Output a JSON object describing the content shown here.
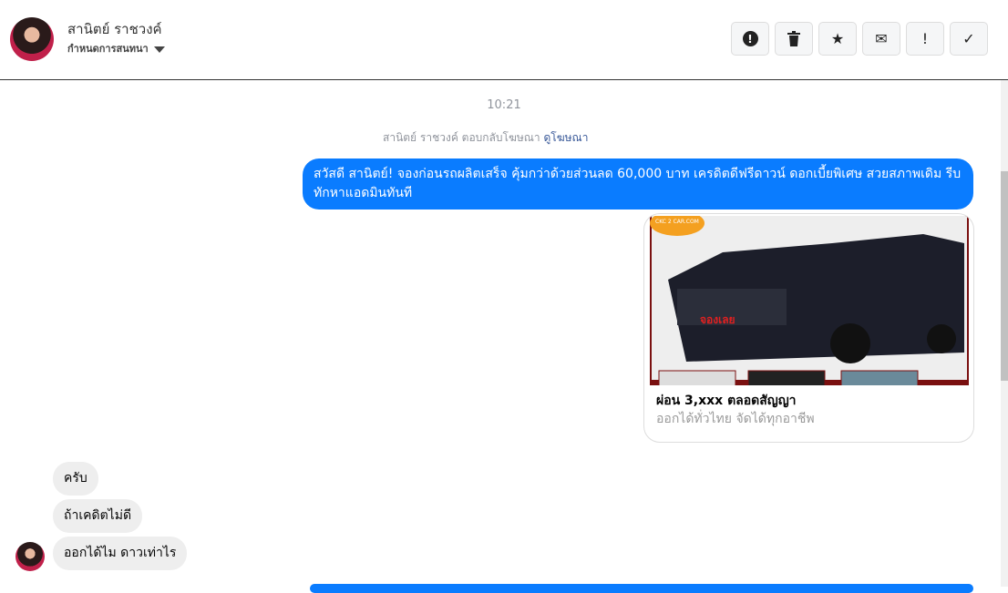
{
  "header": {
    "name": "สานิตย์ ราชวงค์",
    "subtitle": "กำหนดการสนทนา",
    "buttons": [
      {
        "name": "report",
        "icon": "alert-circle-icon",
        "label": "!"
      },
      {
        "name": "delete",
        "icon": "trash-icon"
      },
      {
        "name": "star",
        "icon": "star-icon",
        "label": "★"
      },
      {
        "name": "mark-unread",
        "icon": "envelope-icon",
        "label": "✉"
      },
      {
        "name": "spam",
        "icon": "exclamation-icon",
        "label": "!"
      },
      {
        "name": "done",
        "icon": "check-icon",
        "label": "✓"
      }
    ]
  },
  "thread": {
    "time": "10:21",
    "notice": "สานิตย์ ราชวงค์ ตอบกลับโฆษณา",
    "notice_link": "ดูโฆษณา",
    "outgoing": "สวัสดี สานิตย์! จองก่อนรถผลิตเสร็จ คุ้มกว่าด้วยส่วนลด 60,000 บาท เครดิตดีฟรีดาวน์ ดอกเบี้ยพิเศษ สวยสภาพเดิม รีบทักหาแอดมินทันที",
    "card": {
      "title": "ผ่อน 3,xxx ตลอดสัญญา",
      "subtitle": "ออกได้ทั่วไทย จัดได้ทุกอาชีพ",
      "logo": "CKC 2 CAR.COM",
      "sticker": "จองเลย"
    },
    "incoming": [
      "ครับ",
      "ถ้าเคดิตไม่ดี",
      "ออกได้ไม ดาวเท่าไร"
    ]
  },
  "colors": {
    "accent": "#0a7cff",
    "incoming_bg": "#eeeeee"
  }
}
